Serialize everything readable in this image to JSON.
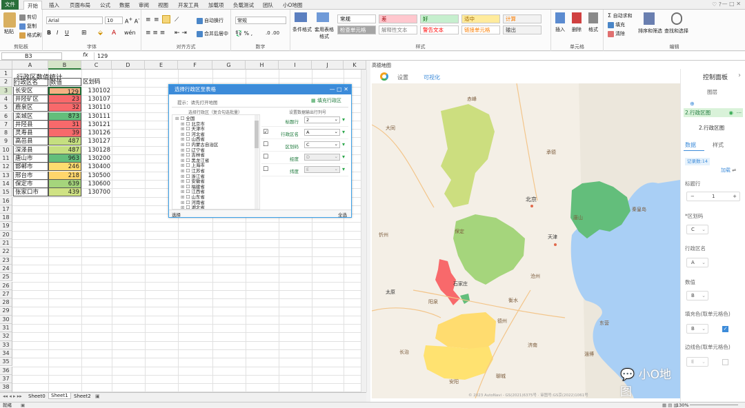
{
  "tabs": [
    "文件",
    "开始",
    "插入",
    "页面布局",
    "公式",
    "数据",
    "审阅",
    "视图",
    "开发工具",
    "加载项",
    "负载测试",
    "团队",
    "小O地图"
  ],
  "ribbon": {
    "clipboard": {
      "paste": "粘贴",
      "cut": "剪切",
      "copy": "复制",
      "format_painter": "格式刷",
      "label": "剪贴板"
    },
    "font": {
      "name": "Arial",
      "size": "10",
      "label": "字体"
    },
    "align": {
      "wrap": "自动换行",
      "merge": "合并后居中",
      "label": "对齐方式"
    },
    "number": {
      "format": "常规",
      "label": "数字"
    },
    "styles": {
      "cond": "条件格式",
      "table": "套用表格格式",
      "label": "样式",
      "cells": [
        {
          "t": "常规",
          "bg": "#ffffff",
          "c": "#000000"
        },
        {
          "t": "差",
          "bg": "#ffc7ce",
          "c": "#9c0006"
        },
        {
          "t": "好",
          "bg": "#c6efce",
          "c": "#006100"
        },
        {
          "t": "适中",
          "bg": "#ffeb9c",
          "c": "#9c6500"
        },
        {
          "t": "计算",
          "bg": "#f2f2f2",
          "c": "#fa7d00"
        },
        {
          "t": "检查单元格",
          "bg": "#a5a5a5",
          "c": "#ffffff"
        },
        {
          "t": "解释性文本",
          "bg": "#ffffff",
          "c": "#7f7f7f"
        },
        {
          "t": "警告文本",
          "bg": "#ffffff",
          "c": "#ff0000"
        },
        {
          "t": "链接单元格",
          "bg": "#ffffff",
          "c": "#fa7d00"
        },
        {
          "t": "输出",
          "bg": "#f2f2f2",
          "c": "#3f3f3f"
        }
      ]
    },
    "cells": {
      "insert": "插入",
      "delete": "删除",
      "format": "格式",
      "label": "单元格"
    },
    "edit": {
      "autosum": "自动求和",
      "fill": "填充",
      "clear": "清除",
      "sort": "排序和筛选",
      "find": "查找和选择",
      "label": "编辑"
    }
  },
  "formula": {
    "namebox": "B3",
    "fx": "fx",
    "value": "129"
  },
  "sheet": {
    "columns": [
      "A",
      "B",
      "C",
      "D",
      "E",
      "F",
      "G",
      "H",
      "I",
      "J",
      "K"
    ],
    "title": "行政区数值统计",
    "headers": [
      "行政区名",
      "数值",
      "区划码"
    ],
    "rows": [
      {
        "name": "长安区",
        "value": "129",
        "code": "130102",
        "color": "#f4b183"
      },
      {
        "name": "井陉矿区",
        "value": "23",
        "code": "130107",
        "color": "#f8696b"
      },
      {
        "name": "鹿泉区",
        "value": "32",
        "code": "130110",
        "color": "#f8696b"
      },
      {
        "name": "栾城区",
        "value": "873",
        "code": "130111",
        "color": "#63be7b"
      },
      {
        "name": "井陉县",
        "value": "31",
        "code": "130121",
        "color": "#f8696b"
      },
      {
        "name": "灵寿县",
        "value": "39",
        "code": "130126",
        "color": "#f8696b"
      },
      {
        "name": "高邑县",
        "value": "487",
        "code": "130127",
        "color": "#c5df80"
      },
      {
        "name": "深泽县",
        "value": "487",
        "code": "130128",
        "color": "#c5df80"
      },
      {
        "name": "唐山市",
        "value": "963",
        "code": "130200",
        "color": "#63be7b"
      },
      {
        "name": "邯郸市",
        "value": "246",
        "code": "130400",
        "color": "#ffdc6f"
      },
      {
        "name": "邢台市",
        "value": "218",
        "code": "130500",
        "color": "#ffd66c"
      },
      {
        "name": "保定市",
        "value": "639",
        "code": "130600",
        "color": "#a5d57c"
      },
      {
        "name": "张家口市",
        "value": "439",
        "code": "130700",
        "color": "#cfe283"
      }
    ],
    "row_numbers": [
      "1",
      "2",
      "3",
      "4",
      "5",
      "6",
      "7",
      "8",
      "9",
      "10",
      "11",
      "12",
      "13",
      "14",
      "15",
      "16",
      "17",
      "18",
      "19",
      "20",
      "21",
      "22",
      "23",
      "24",
      "25",
      "26",
      "27",
      "28",
      "29",
      "30",
      "31",
      "32",
      "33",
      "34",
      "35",
      "36",
      "37",
      "38",
      "39"
    ],
    "sheet_tabs": [
      "Sheet0",
      "Sheet1",
      "Sheet2"
    ]
  },
  "dialog": {
    "title": "选择行政区至表格",
    "hint": "提示：请先打开地图",
    "fill_btn": "填充行政区",
    "left_header": "选择行政区（复合勾选批量）",
    "right_header": "设置数据输出行列号",
    "tree": [
      "全国",
      "北京市",
      "天津市",
      "河北省",
      "山西省",
      "内蒙古自治区",
      "辽宁省",
      "吉林省",
      "黑龙江省",
      "上海市",
      "江苏省",
      "浙江省",
      "安徽省",
      "福建省",
      "江西省",
      "山东省",
      "河南省",
      "湖北省"
    ],
    "fields": [
      {
        "label": "标题行",
        "value": "2",
        "checked": null
      },
      {
        "label": "行政区名",
        "value": "A",
        "checked": true
      },
      {
        "label": "区划码",
        "value": "C",
        "checked": false
      },
      {
        "label": "经度",
        "value": "D",
        "checked": false
      },
      {
        "label": "纬度",
        "value": "E",
        "checked": false
      }
    ],
    "footer_left": "选择",
    "footer_right": "全选"
  },
  "map": {
    "window_title": "高德地图",
    "toolbar": [
      "设置",
      "可视化"
    ],
    "cities": [
      "赤峰",
      "张家口",
      "承德",
      "北京",
      "秦皇岛",
      "唐山",
      "天津",
      "保定",
      "沧州",
      "石家庄",
      "太原",
      "衡水",
      "邢台",
      "德州",
      "邯郸",
      "聊城",
      "济南",
      "淄博",
      "东营",
      "长治",
      "晋城",
      "安阳",
      "新乡",
      "郑州",
      "焦作",
      "濮阳",
      "泰安",
      "忻州",
      "朔州",
      "大同",
      "葫芦岛",
      "锦州",
      "阳泉",
      "晋中",
      "长治",
      "菏泽",
      "鹤壁",
      "临汾",
      "朝阳"
    ],
    "copyright": "© 2023 AutoNavi - GS(2021)6375号 · 审图号:GS京(2022)1061号"
  },
  "panel": {
    "title": "控制面板",
    "layer_header": "图层",
    "layer_item": "2.行政区图",
    "layer_name": "2.行政区图",
    "tabs": [
      "数据",
      "样式"
    ],
    "records": "记录数:14",
    "load": "加载",
    "title_row_label": "标题行",
    "title_row_value": "1",
    "code_label": "*区划码",
    "code_value": "C",
    "name_label": "行政区名",
    "name_value": "A",
    "value_label": "数值",
    "value_value": "B",
    "fill_label": "填充色(取单元格色)",
    "fill_value": "B",
    "line_label": "边线色(取单元格色)",
    "line_value": "E"
  },
  "status": {
    "left": "就绪",
    "zoom": "130%"
  },
  "watermark": "小O地图"
}
